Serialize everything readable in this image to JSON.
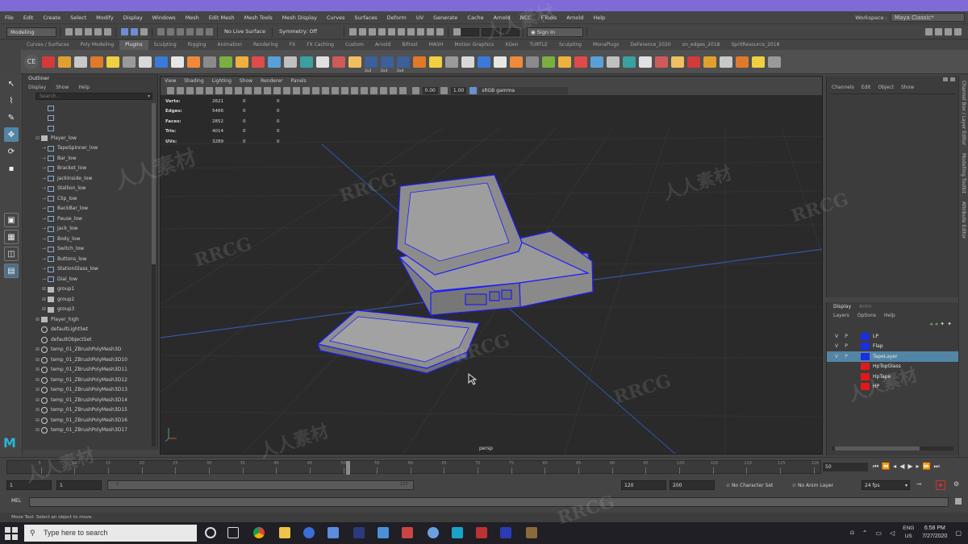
{
  "menubar": {
    "items": [
      "File",
      "Edit",
      "Create",
      "Select",
      "Modify",
      "Display",
      "Windows",
      "Mesh",
      "Edit Mesh",
      "Mesh Tools",
      "Mesh Display",
      "Curves",
      "Surfaces",
      "Deform",
      "UV",
      "Generate",
      "Cache",
      "Arnold",
      "NCC",
      "FTools",
      "Arnold",
      "Help"
    ],
    "workspace_label": "Workspace :",
    "workspace_value": "Maya Classic*"
  },
  "statusline": {
    "mode": "Modeling",
    "no_live_surface": "No Live Surface",
    "symmetry": "Symmetry: Off",
    "sign_in": "Sign In"
  },
  "shelf": {
    "tabs": [
      "Curves / Surfaces",
      "Poly Modeling",
      "Sculpting",
      "Rigging",
      "Animation",
      "Rendering",
      "FX",
      "FX Caching",
      "Custom",
      "Arnold",
      "Bifrost",
      "MASH",
      "Motion Graphics",
      "XGen",
      "TURTLE",
      "Sculpting",
      "MonaPlugs",
      "DeFerence_2020",
      "on_edges_2018",
      "SpritResource_2018"
    ],
    "active_tab": "Plugins",
    "icon_labels": [
      "2x2",
      "2x3",
      "2x4"
    ]
  },
  "outliner": {
    "title": "Outliner",
    "menu": [
      "Display",
      "Show",
      "Help"
    ],
    "search_placeholder": "Search...",
    "items": [
      {
        "label": "",
        "indent": 1,
        "icon": "mesh",
        "dim": true
      },
      {
        "label": "",
        "indent": 1,
        "icon": "mesh",
        "dim": true
      },
      {
        "label": "",
        "indent": 1,
        "icon": "mesh",
        "dim": true
      },
      {
        "label": "Player_low",
        "indent": 0,
        "icon": "grp",
        "exp": "⊟"
      },
      {
        "label": "TapeSpinner_low",
        "indent": 1,
        "icon": "mesh",
        "exp": "→"
      },
      {
        "label": "Bar_low",
        "indent": 1,
        "icon": "mesh",
        "exp": "→"
      },
      {
        "label": "Bracket_low",
        "indent": 1,
        "icon": "mesh",
        "exp": "→"
      },
      {
        "label": "JackInside_low",
        "indent": 1,
        "icon": "mesh",
        "exp": "→"
      },
      {
        "label": "Stallion_low",
        "indent": 1,
        "icon": "mesh",
        "exp": "→"
      },
      {
        "label": "Clip_low",
        "indent": 1,
        "icon": "mesh",
        "exp": "→"
      },
      {
        "label": "BackBar_low",
        "indent": 1,
        "icon": "mesh",
        "exp": "→"
      },
      {
        "label": "Pause_low",
        "indent": 1,
        "icon": "mesh",
        "exp": "→"
      },
      {
        "label": "Jack_low",
        "indent": 1,
        "icon": "mesh",
        "exp": "→"
      },
      {
        "label": "Body_low",
        "indent": 1,
        "icon": "mesh",
        "exp": "→"
      },
      {
        "label": "Switch_low",
        "indent": 1,
        "icon": "mesh",
        "exp": "→"
      },
      {
        "label": "Buttons_low",
        "indent": 1,
        "icon": "mesh",
        "exp": "→"
      },
      {
        "label": "StationGlass_low",
        "indent": 1,
        "icon": "mesh",
        "exp": "→"
      },
      {
        "label": "Dial_low",
        "indent": 1,
        "icon": "mesh",
        "exp": "→"
      },
      {
        "label": "group1",
        "indent": 1,
        "icon": "grp",
        "exp": "⊞"
      },
      {
        "label": "group2",
        "indent": 1,
        "icon": "grp",
        "exp": "⊞"
      },
      {
        "label": "group3",
        "indent": 1,
        "icon": "grp",
        "exp": "⊞"
      },
      {
        "label": "Player_high",
        "indent": 0,
        "icon": "grp",
        "exp": "⊞"
      },
      {
        "label": "defaultLightSet",
        "indent": 0,
        "icon": "set",
        "exp": ""
      },
      {
        "label": "defaultObjectSet",
        "indent": 0,
        "icon": "set",
        "exp": ""
      },
      {
        "label": "temp_01_ZBrushPolyMesh3D",
        "indent": 0,
        "icon": "set",
        "exp": "⊞"
      },
      {
        "label": "temp_01_ZBrushPolyMesh3D10",
        "indent": 0,
        "icon": "set",
        "exp": "⊞"
      },
      {
        "label": "temp_01_ZBrushPolyMesh3D11",
        "indent": 0,
        "icon": "set",
        "exp": "⊞"
      },
      {
        "label": "temp_01_ZBrushPolyMesh3D12",
        "indent": 0,
        "icon": "set",
        "exp": "⊞"
      },
      {
        "label": "temp_01_ZBrushPolyMesh3D13",
        "indent": 0,
        "icon": "set",
        "exp": "⊞"
      },
      {
        "label": "temp_01_ZBrushPolyMesh3D14",
        "indent": 0,
        "icon": "set",
        "exp": "⊞"
      },
      {
        "label": "temp_01_ZBrushPolyMesh3D15",
        "indent": 0,
        "icon": "set",
        "exp": "⊞"
      },
      {
        "label": "temp_01_ZBrushPolyMesh3D16",
        "indent": 0,
        "icon": "set",
        "exp": "⊞"
      },
      {
        "label": "temp_01_ZBrushPolyMesh3D17",
        "indent": 0,
        "icon": "set",
        "exp": "⊞"
      }
    ]
  },
  "viewport": {
    "menu": [
      "View",
      "Shading",
      "Lighting",
      "Show",
      "Renderer",
      "Panels"
    ],
    "exposure": "0.00",
    "gamma": "1.00",
    "color_space": "sRGB gamma",
    "camera": "persp",
    "hud": [
      {
        "label": "Verts:",
        "v1": "2621",
        "v2": "0",
        "v3": "0"
      },
      {
        "label": "Edges:",
        "v1": "5466",
        "v2": "0",
        "v3": "0"
      },
      {
        "label": "Faces:",
        "v1": "2852",
        "v2": "0",
        "v3": "0"
      },
      {
        "label": "Tris:",
        "v1": "4014",
        "v2": "0",
        "v3": "0"
      },
      {
        "label": "UVs:",
        "v1": "3289",
        "v2": "0",
        "v3": "0"
      }
    ]
  },
  "channelbox": {
    "menu": [
      "Channels",
      "Edit",
      "Object",
      "Show"
    ]
  },
  "side_tabs": [
    "Channel Box / Layer Editor",
    "Modelling Toolkit",
    "Attribute Editor"
  ],
  "layers": {
    "tabs": [
      "Display",
      "Anim"
    ],
    "menu": [
      "Layers",
      "Options",
      "Help"
    ],
    "rows": [
      {
        "v": "V",
        "p": "P",
        "color": "#1a2fe0",
        "name": "LP",
        "selected": false
      },
      {
        "v": "V",
        "p": "P",
        "color": "#1a2fe0",
        "name": "Flap",
        "selected": false
      },
      {
        "v": "V",
        "p": "P",
        "color": "#1a2fe0",
        "name": "TapeLayer",
        "selected": true
      },
      {
        "v": "",
        "p": "",
        "color": "#e01a1a",
        "name": "HpTopGlass",
        "selected": false
      },
      {
        "v": "",
        "p": "",
        "color": "#e01a1a",
        "name": "HpTape",
        "selected": false
      },
      {
        "v": "",
        "p": "",
        "color": "#e01a1a",
        "name": "HP",
        "selected": false
      }
    ]
  },
  "timeline": {
    "ticks": [
      "5",
      "10",
      "15",
      "20",
      "25",
      "30",
      "35",
      "40",
      "45",
      "50",
      "55",
      "60",
      "65",
      "70",
      "75",
      "80",
      "85",
      "90",
      "95",
      "100",
      "105",
      "110",
      "115",
      "120"
    ],
    "current_frame": "50",
    "current_frame_fraction": 0.417
  },
  "range": {
    "start": "1",
    "inner_start": "1",
    "slider_start": "1",
    "slider_end": "120",
    "end": "120",
    "outer_end": "200",
    "character_set": "No Character Set",
    "anim_layer": "No Anim Layer",
    "fps": "24 fps"
  },
  "command": {
    "label": "MEL",
    "help": "Move Tool: Select an object to move."
  },
  "taskbar": {
    "search_placeholder": "Type here to search",
    "lang_top": "ENG",
    "lang_bottom": "US",
    "time": "6:58 PM",
    "date": "7/27/2020"
  },
  "watermarks": [
    "RRCG",
    "人人素材",
    "RRCG",
    "人人素材",
    "RRCG",
    "人人素材",
    "RRCG",
    "人人素材",
    "RRCG",
    "人人素材",
    "RRCG",
    "人人素材"
  ]
}
